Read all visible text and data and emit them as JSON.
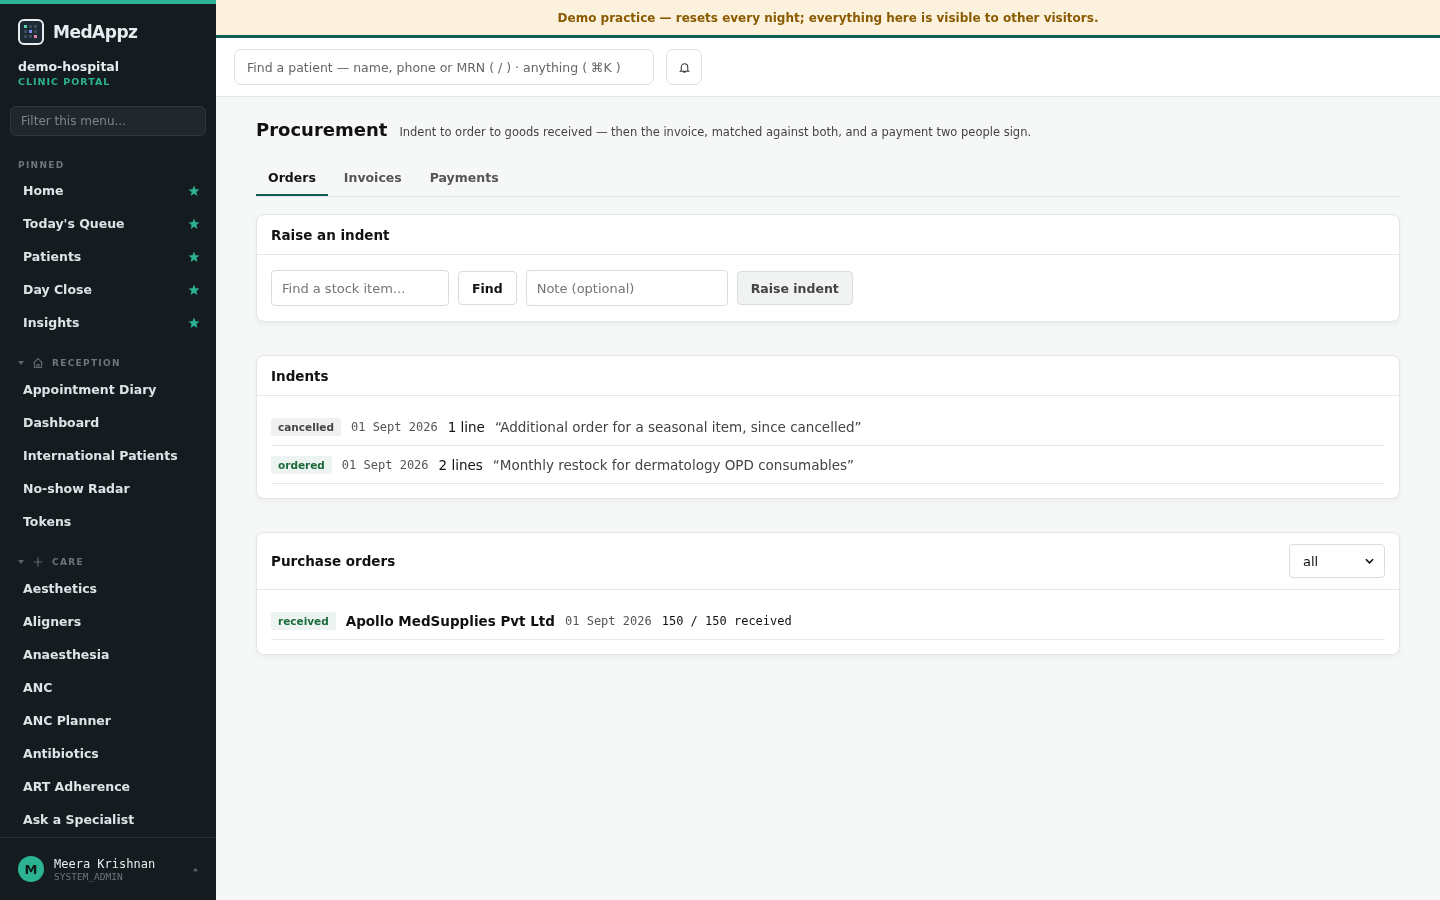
{
  "sidebar": {
    "brand": "MedAppz",
    "org": "demo-hospital",
    "portal": "CLINIC PORTAL",
    "filter": {
      "placeholder": "Filter this menu..."
    },
    "pinned": {
      "label": "PINNED",
      "items": [
        {
          "label": "Home",
          "pinned": true
        },
        {
          "label": "Today's Queue",
          "pinned": true
        },
        {
          "label": "Patients",
          "pinned": true
        },
        {
          "label": "Day Close",
          "pinned": true
        },
        {
          "label": "Insights",
          "pinned": true
        }
      ]
    },
    "groups": [
      {
        "label": "RECEPTION",
        "expanded": true,
        "items": [
          "Appointment Diary",
          "Dashboard",
          "International Patients",
          "No-show Radar",
          "Tokens"
        ]
      },
      {
        "label": "CARE",
        "expanded": true,
        "items": [
          "Aesthetics",
          "Aligners",
          "Anaesthesia",
          "ANC",
          "ANC Planner",
          "Antibiotics",
          "ART Adherence",
          "Ask a Specialist"
        ]
      }
    ],
    "user": {
      "initial": "M",
      "name": "Meera Krishnan",
      "role": "SYSTEM_ADMIN"
    }
  },
  "banner": "Demo practice — resets every night; everything here is visible to other visitors.",
  "topbar": {
    "search": {
      "placeholder": "Find a patient — name, phone or MRN ( / ) · anything ( ⌘K )"
    }
  },
  "page": {
    "title": "Procurement",
    "subtitle": "Indent to order to goods received — then the invoice, matched against both, and a payment two people sign.",
    "tabs": [
      {
        "label": "Orders",
        "selected": true
      },
      {
        "label": "Invoices",
        "selected": false
      },
      {
        "label": "Payments",
        "selected": false
      }
    ]
  },
  "raise": {
    "title": "Raise an indent",
    "item": {
      "placeholder": "Find a stock item..."
    },
    "find": "Find",
    "note": {
      "placeholder": "Note (optional)"
    },
    "submit": {
      "label": "Raise indent",
      "disabled": true
    }
  },
  "indents": {
    "title": "Indents",
    "rows": [
      {
        "status": "cancelled",
        "color": "#444444",
        "date": "01 Sept 2026",
        "lines": "1 line",
        "note": "“Additional order for a seasonal item, since cancelled”"
      },
      {
        "status": "ordered",
        "color": "#1c6b3a",
        "date": "01 Sept 2026",
        "lines": "2 lines",
        "note": "“Monthly restock for dermatology OPD consumables”"
      }
    ]
  },
  "orders": {
    "title": "Purchase orders",
    "filter": "all",
    "rows": [
      {
        "status": "received",
        "color": "#1c6b3a",
        "supplier": "Apollo MedSupplies Pvt Ltd",
        "date": "01 Sept 2026",
        "quantity": "150 / 150 received"
      }
    ]
  }
}
